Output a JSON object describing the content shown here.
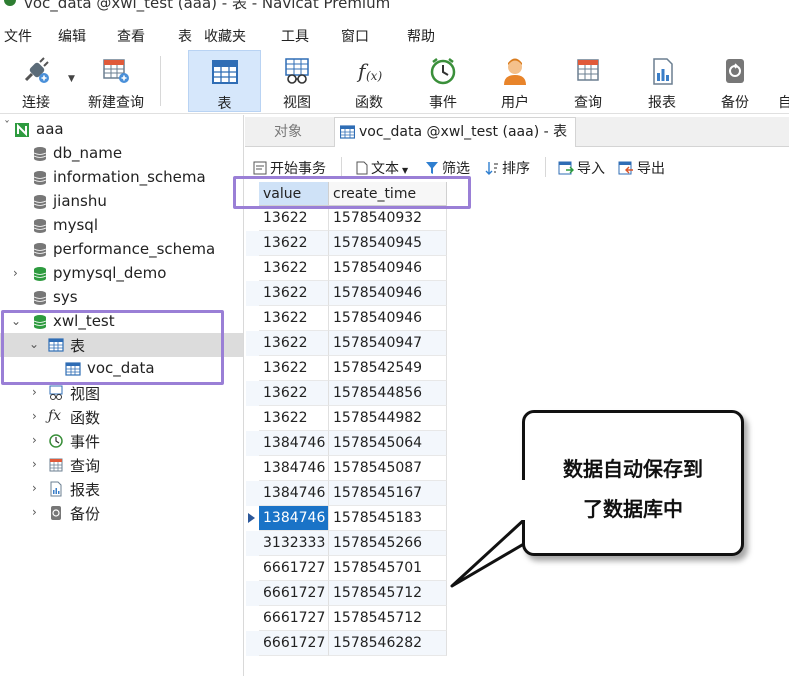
{
  "window": {
    "title": "voc_data @xwl_test (aaa) - 表 - Navicat Premium"
  },
  "menubar": [
    "文件",
    "编辑",
    "查看",
    "表",
    "收藏夹",
    "工具",
    "窗口",
    "帮助"
  ],
  "toolbar": {
    "buttons": [
      {
        "label": "连接",
        "icon": "plug-icon"
      },
      {
        "label": "新建查询",
        "icon": "new-query-icon"
      },
      {
        "label": "表",
        "icon": "table-icon",
        "active": true
      },
      {
        "label": "视图",
        "icon": "view-icon"
      },
      {
        "label": "函数",
        "icon": "function-icon"
      },
      {
        "label": "事件",
        "icon": "clock-icon"
      },
      {
        "label": "用户",
        "icon": "user-icon"
      },
      {
        "label": "查询",
        "icon": "query-icon"
      },
      {
        "label": "报表",
        "icon": "report-icon"
      },
      {
        "label": "备份",
        "icon": "backup-icon"
      },
      {
        "label": "自",
        "icon": "automation-icon"
      }
    ]
  },
  "sidebar": {
    "connection": "aaa",
    "databases": [
      "db_name",
      "information_schema",
      "jianshu",
      "mysql",
      "performance_schema",
      "pymysql_demo",
      "sys",
      "xwl_test"
    ],
    "xwl_test_children": [
      "表",
      "视图",
      "函数",
      "事件",
      "查询",
      "报表",
      "备份"
    ],
    "table_item": "voc_data"
  },
  "tabs": {
    "objects": "对象",
    "active": "voc_data @xwl_test (aaa) - 表"
  },
  "data_toolbar": {
    "begin_transaction": "开始事务",
    "text": "文本",
    "filter": "筛选",
    "sort": "排序",
    "import": "导入",
    "export": "导出"
  },
  "grid": {
    "columns": [
      "value",
      "create_time"
    ],
    "rows": [
      [
        "13622",
        "1578540932"
      ],
      [
        "13622",
        "1578540945"
      ],
      [
        "13622",
        "1578540946"
      ],
      [
        "13622",
        "1578540946"
      ],
      [
        "13622",
        "1578540946"
      ],
      [
        "13622",
        "1578540947"
      ],
      [
        "13622",
        "1578542549"
      ],
      [
        "13622",
        "1578544856"
      ],
      [
        "13622",
        "1578544982"
      ],
      [
        "1384746",
        "1578545064"
      ],
      [
        "1384746",
        "1578545087"
      ],
      [
        "1384746",
        "1578545167"
      ],
      [
        "1384746",
        "1578545183"
      ],
      [
        "3132333",
        "1578545266"
      ],
      [
        "6661727",
        "1578545701"
      ],
      [
        "6661727",
        "1578545712"
      ],
      [
        "6661727",
        "1578545712"
      ],
      [
        "6661727",
        "1578546282"
      ]
    ],
    "current_row": 12
  },
  "callout": {
    "line1": "数据自动保存到",
    "line2": "了数据库中"
  },
  "colors": {
    "highlight_box": "#9a7fd6",
    "selection": "#1a73c7",
    "active_toolbar": "#d6e7fb"
  }
}
